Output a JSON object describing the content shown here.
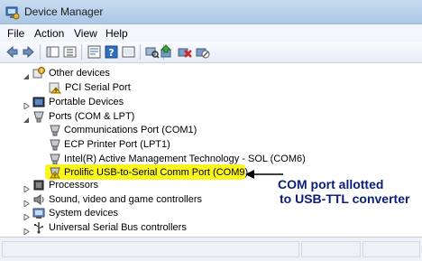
{
  "window": {
    "title": "Device Manager"
  },
  "menu": [
    "File",
    "Action",
    "View",
    "Help"
  ],
  "toolbar": {
    "buttons": [
      "back-icon",
      "forward-icon",
      "show-hide-tree-icon",
      "properties-icon",
      "help-icon",
      "console-tree-icon",
      "scan-hardware-icon",
      "update-driver-icon",
      "uninstall-icon",
      "disable-icon"
    ]
  },
  "tree": {
    "other_devices": "Other devices",
    "pci_serial_port": "PCI Serial Port",
    "portable_devices": "Portable Devices",
    "ports": "Ports (COM & LPT)",
    "ports_children": [
      "Communications Port (COM1)",
      "ECP Printer Port (LPT1)",
      "Intel(R) Active Management Technology - SOL (COM6)",
      "Prolific USB-to-Serial Comm Port (COM9)"
    ],
    "processors": "Processors",
    "sound": "Sound, video and game controllers",
    "system_devices": "System devices",
    "usb": "Universal Serial Bus controllers"
  },
  "annotation": {
    "line1": "COM port allotted",
    "line2": "to USB-TTL converter",
    "color": "#0a1e7a",
    "highlight_color": "#fbf51e"
  }
}
